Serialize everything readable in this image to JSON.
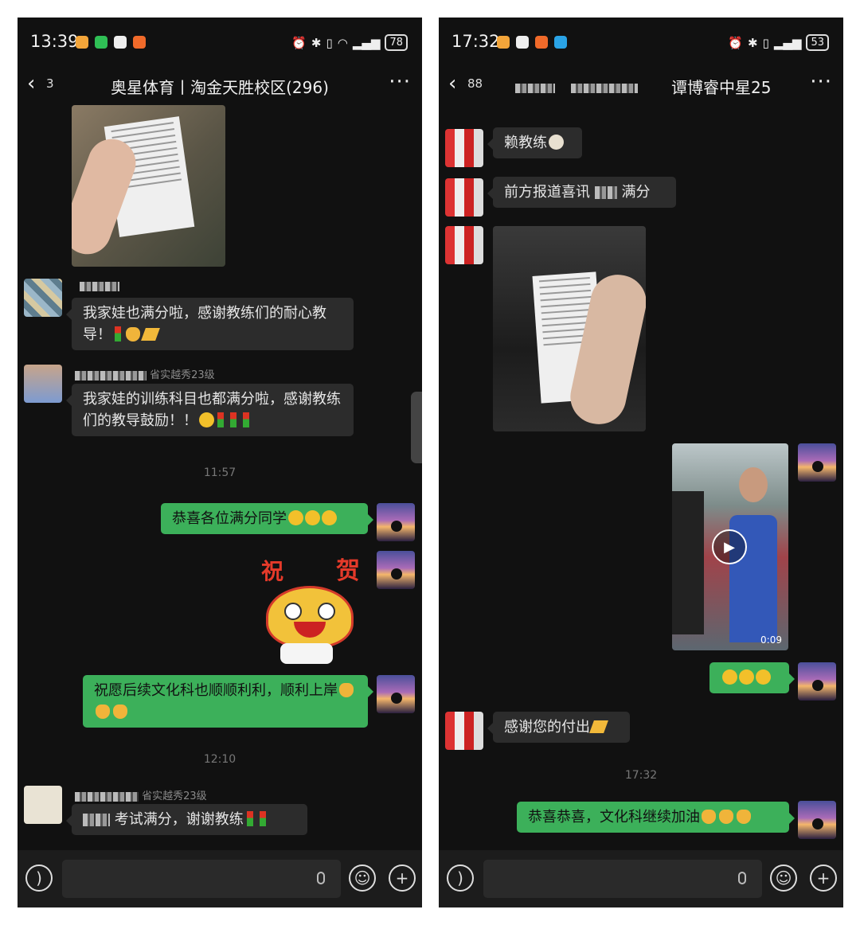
{
  "left": {
    "status": {
      "time": "13:39",
      "battery": "78"
    },
    "header": {
      "back_count": "3",
      "title": "奥星体育丨淘金天胜校区(296)"
    },
    "messages": [
      {
        "text": "我家娃也满分啦，感谢教练们的耐心教导！"
      },
      {
        "sender_suffix": "省实越秀23级",
        "text": "我家娃的训练科目也都满分啦，感谢教练们的教导鼓励！！"
      },
      {
        "self_text": "恭喜各位满分同学"
      },
      {
        "sticker_left": "祝",
        "sticker_right": "贺"
      },
      {
        "self_text": "祝愿后续文化科也顺顺利利，顺利上岸"
      },
      {
        "sender_suffix": "省实越秀23级",
        "text": "考试满分，谢谢教练"
      }
    ],
    "timestamps": [
      "11:57",
      "12:10"
    ]
  },
  "right": {
    "status": {
      "time": "17:32",
      "battery": "53"
    },
    "header": {
      "back_count": "88",
      "title": "谭博睿中星25"
    },
    "messages": [
      {
        "text": "赖教练"
      },
      {
        "text_a": "前方报道喜讯",
        "text_b": "满分"
      },
      {
        "video_duration": "0:09"
      },
      {
        "text": "感谢您的付出"
      },
      {
        "self_text": "恭喜恭喜，文化科继续加油"
      }
    ],
    "timestamps": [
      "17:32"
    ]
  }
}
